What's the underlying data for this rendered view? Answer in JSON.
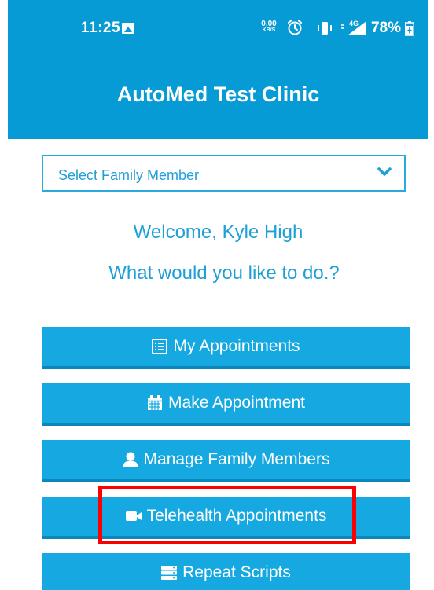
{
  "status_bar": {
    "time": "11:25",
    "speed_value": "0.00",
    "speed_unit": "KB/S",
    "network": "4G",
    "battery": "78%"
  },
  "header": {
    "title": "AutoMed Test Clinic"
  },
  "family_select": {
    "selected": "Select Family Member"
  },
  "greeting": {
    "welcome": "Welcome, Kyle High",
    "prompt": "What would you like to do.?"
  },
  "actions": [
    {
      "label": "My Appointments",
      "icon": "list-icon"
    },
    {
      "label": "Make Appointment",
      "icon": "calendar-icon"
    },
    {
      "label": "Manage Family Members",
      "icon": "user-icon"
    },
    {
      "label": "Telehealth Appointments",
      "icon": "video-camera-icon"
    },
    {
      "label": "Repeat Scripts",
      "icon": "server-icon"
    }
  ],
  "colors": {
    "header_blue": "#079bd6",
    "button_blue": "#16a9e1",
    "text_blue": "#1e9fd5",
    "highlight": "#ff0000"
  }
}
